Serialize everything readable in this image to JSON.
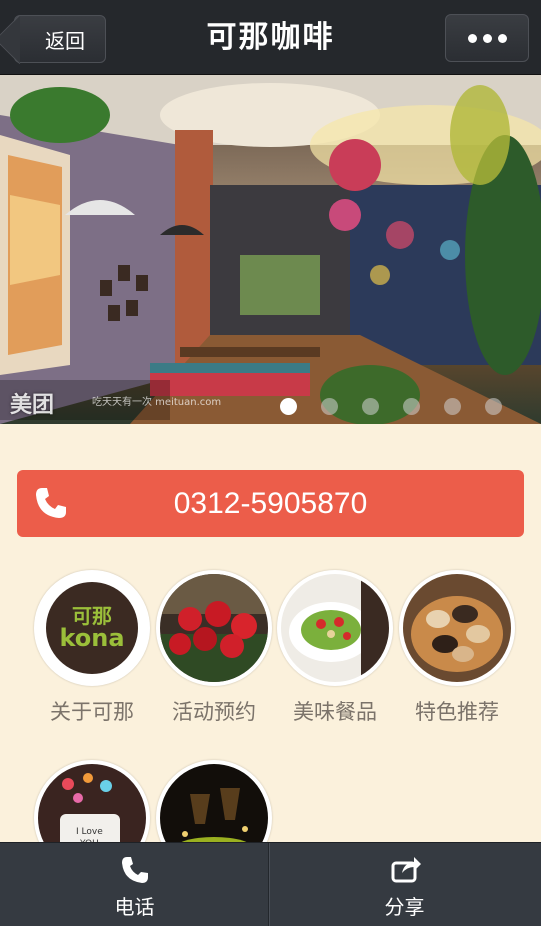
{
  "header": {
    "back_label": "返回",
    "title": "可那咖啡",
    "more_icon": "more-dots-icon"
  },
  "banner": {
    "watermark": "美团",
    "watermark_sub": "吃天天有一次 meituan.com",
    "slide_count": 6,
    "active_slide": 1
  },
  "contact": {
    "phone": "0312-5905870",
    "icon": "phone-icon"
  },
  "menu": [
    {
      "label": "关于可那",
      "logo_text_top": "可那",
      "logo_text_bottom": "kona"
    },
    {
      "label": "活动预约"
    },
    {
      "label": "美味餐品"
    },
    {
      "label": "特色推荐"
    },
    {
      "label": ""
    },
    {
      "label": ""
    }
  ],
  "bottom_bar": {
    "call_label": "电话",
    "share_label": "分享"
  },
  "colors": {
    "header_bg": "#25282c",
    "page_bg": "#fbf1dc",
    "phone_bar": "#ec5d4a",
    "bottom_bar": "#353a41",
    "label": "#7b736a"
  }
}
